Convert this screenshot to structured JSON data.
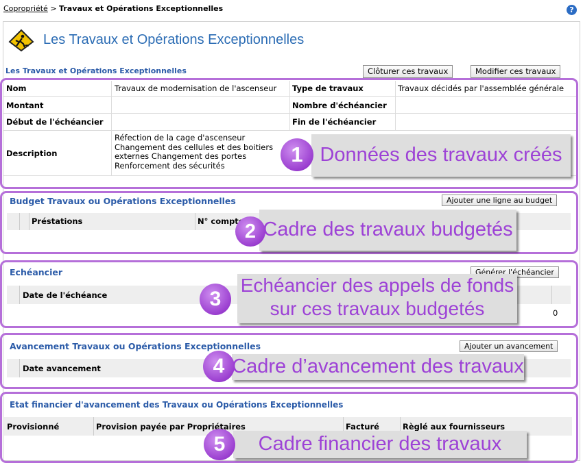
{
  "breadcrumb": {
    "link": "Copropriété",
    "separator": " > ",
    "current": "Travaux et Opérations Exceptionnelles"
  },
  "help_label": "?",
  "page_title": "Les Travaux et Opérations Exceptionnelles",
  "subtitle": "Les Travaux et Opérations Exceptionnelles",
  "buttons": {
    "close_works": "Clôturer ces travaux",
    "modify_works": "Modifier ces travaux",
    "add_budget_line": "Ajouter une ligne au budget",
    "generate_schedule": "Générer l'échéancier",
    "add_progress": "Ajouter un avancement"
  },
  "details": {
    "nom_label": "Nom",
    "nom_value": "Travaux de modernisation de l'ascenseur",
    "type_label": "Type de travaux",
    "type_value": "Travaux décidés par l'assemblée générale",
    "montant_label": "Montant",
    "nb_echeancier_label": "Nombre d'échéancier",
    "debut_label": "Début de l'échéancier",
    "fin_label": "Fin de l'échéancier",
    "description_label": "Description",
    "description_lines": [
      "Réfection de la cage d'ascenseur",
      "Changement des cellules et des boitiers",
      "externes Changement des portes",
      "Renforcement des sécurités"
    ]
  },
  "budget": {
    "title": "Budget Travaux ou Opérations Exceptionnelles",
    "col_prestations": "Préstations",
    "col_compte": "N° compte"
  },
  "schedule": {
    "title": "Echéancier",
    "col_date": "Date de l'échéance",
    "total": "0"
  },
  "progress": {
    "title": "Avancement Travaux ou Opérations Exceptionnelles",
    "col_date": "Date avancement"
  },
  "financial": {
    "title": "Etat financier d'avancement des Travaux ou Opérations Exceptionnelles",
    "col_provisionne": "Provisionné",
    "col_provision_payee": "Provision payée par Propriétaires",
    "col_facture": "Facturé",
    "col_regle": "Règlé aux fournisseurs"
  },
  "annotations": [
    {
      "number": "1",
      "text": "Données des travaux créés"
    },
    {
      "number": "2",
      "text": "Cadre des travaux budgetés"
    },
    {
      "number": "3",
      "line1": "Echéancier des appels de fonds",
      "line2": "sur ces travaux budgetés"
    },
    {
      "number": "4",
      "text": "Cadre d’avancement des travaux"
    },
    {
      "number": "5",
      "text": "Cadre financier des travaux"
    }
  ],
  "colors": {
    "accent_purple": "#b56fd9",
    "title_blue": "#2b6cb4",
    "section_blue": "#2b5ba8"
  },
  "icons": {
    "header": "road-works-sign-icon",
    "help": "help-icon"
  }
}
